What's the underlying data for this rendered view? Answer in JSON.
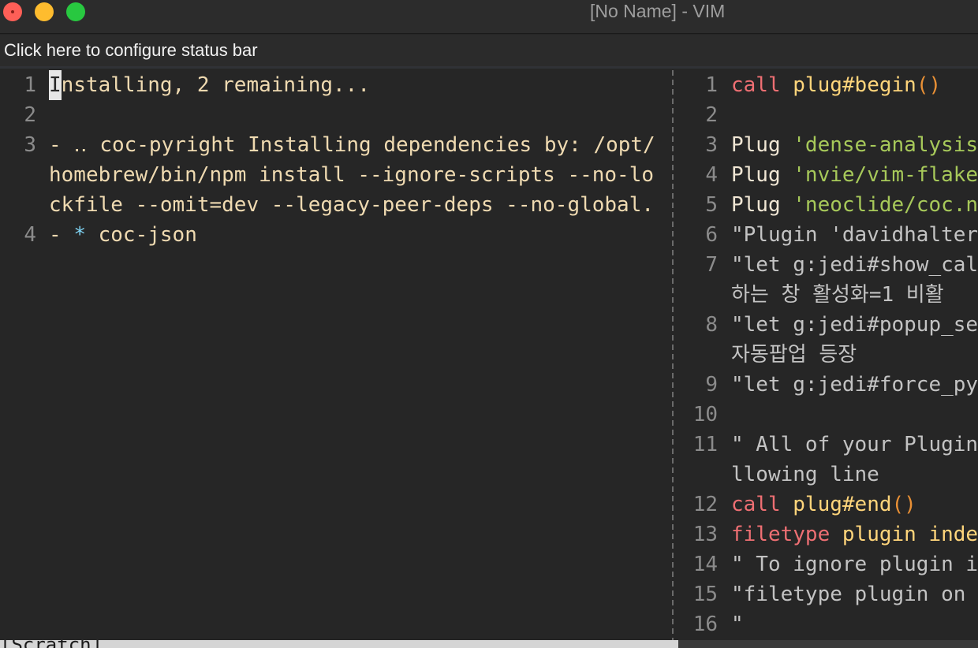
{
  "window": {
    "title": "[No Name] - VIM"
  },
  "statusbar_config": {
    "label": "Click here to configure status bar"
  },
  "left_pane": {
    "lines": [
      {
        "ln": "1",
        "text": "nstalling, 2 remaining...",
        "cursor_char": "I"
      },
      {
        "ln": "2",
        "text": ""
      },
      {
        "ln": "3",
        "text": "- ‥ coc-pyright Installing dependencies by: /opt/"
      },
      {
        "ln": "",
        "text": "homebrew/bin/npm install --ignore-scripts --no-lo"
      },
      {
        "ln": "",
        "text": "ckfile --omit=dev --legacy-peer-deps --no-global."
      },
      {
        "ln": "4",
        "prefix": "- ",
        "star": "*",
        "text": " coc-json"
      }
    ]
  },
  "right_pane": {
    "lines": [
      {
        "ln": "1",
        "parts": [
          {
            "t": "call",
            "c": "keyword"
          },
          {
            "t": " ",
            "c": "default"
          },
          {
            "t": "plug#begin",
            "c": "func"
          },
          {
            "t": "()",
            "c": "paren"
          }
        ]
      },
      {
        "ln": "2",
        "parts": []
      },
      {
        "ln": "3",
        "parts": [
          {
            "t": "Plug",
            "c": "white"
          },
          {
            "t": " ",
            "c": "default"
          },
          {
            "t": "'dense-analysis",
            "c": "string"
          }
        ]
      },
      {
        "ln": "4",
        "parts": [
          {
            "t": "Plug",
            "c": "white"
          },
          {
            "t": " ",
            "c": "default"
          },
          {
            "t": "'nvie/vim-flake",
            "c": "string"
          }
        ]
      },
      {
        "ln": "5",
        "parts": [
          {
            "t": "Plug",
            "c": "white"
          },
          {
            "t": " ",
            "c": "default"
          },
          {
            "t": "'neoclide/coc.n",
            "c": "string"
          }
        ]
      },
      {
        "ln": "6",
        "parts": [
          {
            "t": "\"Plugin 'davidhalter",
            "c": "comment"
          }
        ]
      },
      {
        "ln": "7",
        "parts": [
          {
            "t": "\"let g:jedi#show_cal",
            "c": "comment"
          }
        ]
      },
      {
        "ln": "",
        "parts": [
          {
            "t": "하는 창 활성화=1 비활",
            "c": "comment"
          }
        ]
      },
      {
        "ln": "8",
        "parts": [
          {
            "t": "\"let g:jedi#popup_se",
            "c": "comment"
          }
        ]
      },
      {
        "ln": "",
        "parts": [
          {
            "t": "자동팝업 등장",
            "c": "comment"
          }
        ]
      },
      {
        "ln": "9",
        "parts": [
          {
            "t": "\"let g:jedi#force_py",
            "c": "comment"
          }
        ]
      },
      {
        "ln": "10",
        "parts": []
      },
      {
        "ln": "11",
        "parts": [
          {
            "t": "\" All of your Plugin",
            "c": "comment"
          }
        ]
      },
      {
        "ln": "",
        "parts": [
          {
            "t": "llowing line",
            "c": "comment"
          }
        ]
      },
      {
        "ln": "12",
        "parts": [
          {
            "t": "call",
            "c": "keyword"
          },
          {
            "t": " ",
            "c": "default"
          },
          {
            "t": "plug#end",
            "c": "func"
          },
          {
            "t": "()",
            "c": "paren"
          }
        ]
      },
      {
        "ln": "13",
        "parts": [
          {
            "t": "filetype",
            "c": "keyword"
          },
          {
            "t": " ",
            "c": "default"
          },
          {
            "t": "plugin inde",
            "c": "func"
          }
        ]
      },
      {
        "ln": "14",
        "parts": [
          {
            "t": "\" To ignore plugin i",
            "c": "comment"
          }
        ]
      },
      {
        "ln": "15",
        "parts": [
          {
            "t": "\"filetype plugin on",
            "c": "comment"
          }
        ]
      },
      {
        "ln": "16",
        "parts": [
          {
            "t": "\"",
            "c": "comment"
          }
        ]
      }
    ]
  },
  "status": {
    "left_label": "[Scratch]"
  },
  "colors": {
    "background": "#262626",
    "keyword": "#ee6f73",
    "string": "#a7c95a",
    "func": "#ffd57b",
    "paren": "#e99035",
    "comment": "#c3c3c3",
    "default_text": "#efdab1",
    "star": "#7fd3f3"
  }
}
